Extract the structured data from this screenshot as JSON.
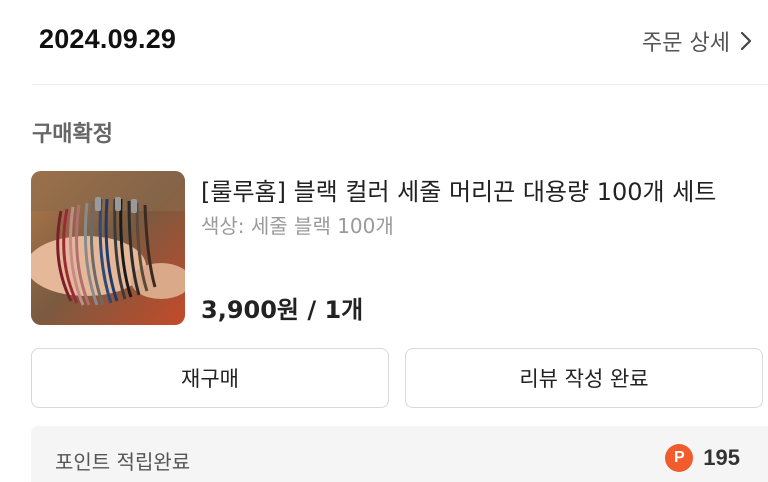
{
  "header": {
    "order_date": "2024.09.29",
    "order_detail_label": "주문 상세"
  },
  "order": {
    "status": "구매확정",
    "product": {
      "name": "[룰루홈] 블랙 컬러 세줄 머리끈 대용량 100개 세트",
      "option": "색상: 세줄 블랙 100개",
      "price": "3,900원 / 1개",
      "image_icon": "hair-tie-product-photo"
    },
    "actions": {
      "reorder_label": "재구매",
      "review_label": "리뷰 작성 완료"
    },
    "points": {
      "label": "포인트 적립완료",
      "icon_letter": "P",
      "value": "195",
      "icon_color": "#f25c2c"
    }
  },
  "colors": {
    "accent_points": "#f25c2c",
    "border": "#d9d9d9",
    "muted_text": "#9a9a9a"
  }
}
